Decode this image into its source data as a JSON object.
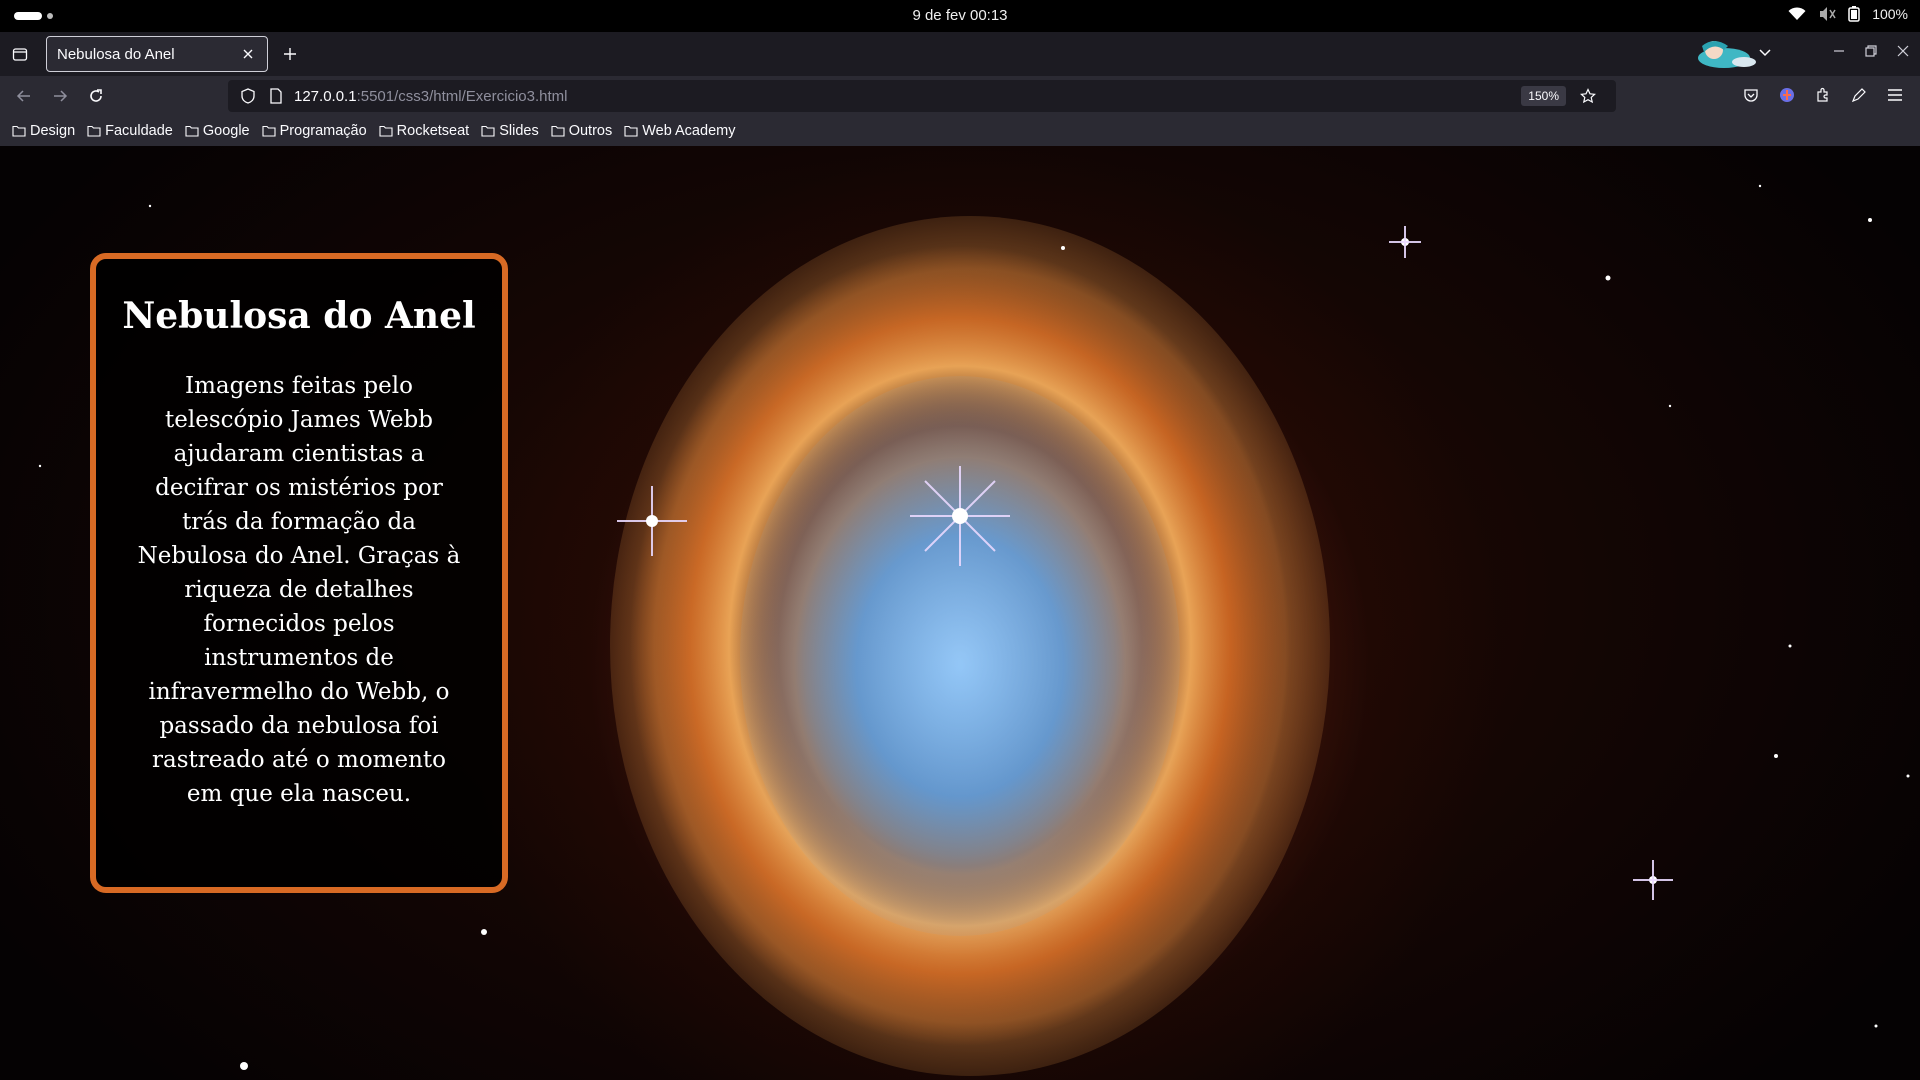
{
  "system": {
    "clock": "9 de fev  00:13",
    "battery": "100%"
  },
  "browser": {
    "tab": {
      "title": "Nebulosa do Anel"
    },
    "url": {
      "host": "127.0.0.1",
      "rest": ":5501/css3/html/Exercicio3.html"
    },
    "zoom": "150%",
    "bookmarks": [
      "Design",
      "Faculdade",
      "Google",
      "Programação",
      "Rocketseat",
      "Slides",
      "Outros",
      "Web Academy"
    ]
  },
  "page": {
    "card": {
      "title": "Nebulosa do Anel",
      "text": "Imagens feitas pelo telescópio James Webb ajudaram cientistas a decifrar os mistérios por trás da formação da Nebulosa do Anel. Graças à riqueza de detalhes fornecidos pelos instrumentos de infravermelho do Webb, o passado da nebulosa foi rastreado até o momento em que ela nasceu."
    }
  },
  "icons": {
    "tray": [
      "wifi-icon",
      "volume-muted-icon",
      "battery-icon"
    ],
    "toolbar": [
      "pocket-icon",
      "extension-icon",
      "puzzle-icon",
      "pen-icon",
      "menu-icon"
    ]
  }
}
